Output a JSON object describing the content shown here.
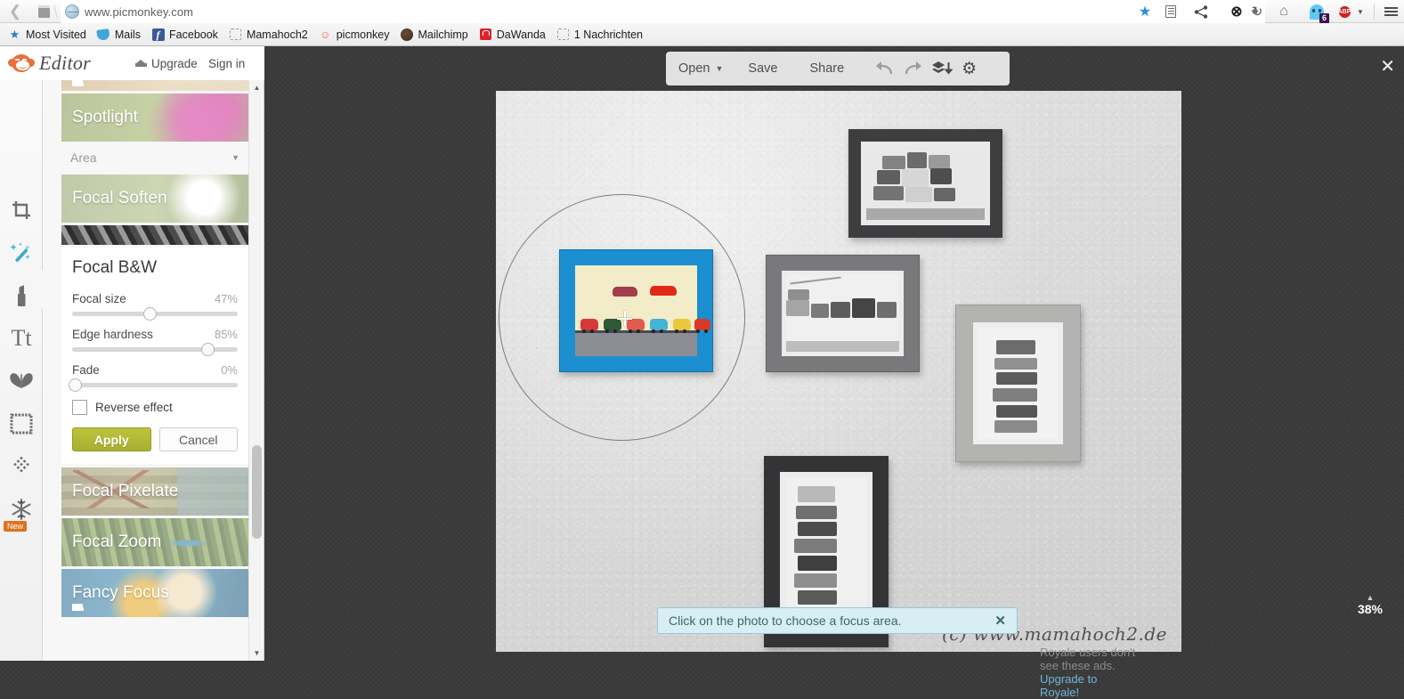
{
  "browser": {
    "url": "www.picmonkey.com",
    "back_icon": "back-arrow-icon",
    "reload_icon": "reload-icon",
    "bookmarks": [
      {
        "label": "Most Visited",
        "icon": "star-icon"
      },
      {
        "label": "Mails",
        "icon": "mail-icon"
      },
      {
        "label": "Facebook",
        "icon": "facebook-icon"
      },
      {
        "label": "Mamahoch2",
        "icon": "blank-favicon"
      },
      {
        "label": "picmonkey",
        "icon": "picmonkey-icon"
      },
      {
        "label": "Mailchimp",
        "icon": "mailchimp-icon"
      },
      {
        "label": "DaWanda",
        "icon": "dawanda-icon"
      },
      {
        "label": "1 Nachrichten",
        "icon": "blank-favicon"
      }
    ],
    "toolbar_icons": [
      "bookmark-star-icon",
      "reader-icon",
      "share-icon",
      "screenshot-icon",
      "chevron-down-icon",
      "home-icon",
      "ghostery-icon",
      "adblock-icon",
      "chevron-down-icon",
      "hamburger-menu-icon"
    ],
    "ghostery_badge": "6",
    "adblock_label": "ABP"
  },
  "app": {
    "logo_text": "Editor",
    "logo_icon": "monkey-icon",
    "upgrade_label": "Upgrade",
    "upgrade_icon": "crown-icon",
    "signin_label": "Sign in",
    "close_icon": "close-icon"
  },
  "tools": [
    {
      "name": "crop",
      "icon": "crop-icon",
      "active": false
    },
    {
      "name": "effects",
      "icon": "magic-wand-icon",
      "active": true
    },
    {
      "name": "touch-up",
      "icon": "lipstick-icon",
      "active": false
    },
    {
      "name": "text",
      "icon": "text-icon",
      "label": "Tt",
      "active": false
    },
    {
      "name": "overlays",
      "icon": "butterfly-icon",
      "active": false
    },
    {
      "name": "frames",
      "icon": "frame-icon",
      "active": false
    },
    {
      "name": "textures",
      "icon": "texture-icon",
      "active": false
    },
    {
      "name": "seasonal",
      "icon": "snowflake-icon",
      "badge": "New",
      "active": false
    }
  ],
  "toolbar": {
    "open_label": "Open",
    "open_caret_icon": "chevron-down-icon",
    "save_label": "Save",
    "share_label": "Share",
    "undo_icon": "undo-icon",
    "redo_icon": "redo-icon",
    "layers_icon": "layers-down-icon",
    "settings_icon": "gear-icon"
  },
  "effects_panel": {
    "area_label": "Area",
    "area_caret_icon": "chevron-down-icon",
    "scroll_up_icon": "triangle-up-icon",
    "scroll_down_icon": "triangle-down-icon",
    "items_above": [
      {
        "label": "",
        "premium": true,
        "thumb": "th-gold"
      },
      {
        "label": "Spotlight",
        "premium": false,
        "thumb": "th-spotlight"
      }
    ],
    "items": [
      {
        "label": "Focal Soften",
        "premium": false,
        "thumb": "th-soften"
      },
      {
        "label": "Focal B&W",
        "premium": false,
        "thumb": "th-bw"
      }
    ],
    "items_below": [
      {
        "label": "Focal Pixelate",
        "premium": false,
        "thumb": "th-pixelate"
      },
      {
        "label": "Focal Zoom",
        "premium": false,
        "thumb": "th-zoom"
      },
      {
        "label": "Fancy Focus",
        "premium": true,
        "thumb": "th-fancy"
      }
    ],
    "focal_card": {
      "title": "Focal B&W",
      "sliders": [
        {
          "label": "Focal size",
          "value": "47%",
          "pos": 47
        },
        {
          "label": "Edge hardness",
          "value": "85%",
          "pos": 82
        },
        {
          "label": "Fade",
          "value": "0%",
          "pos": 0
        }
      ],
      "reverse_label": "Reverse effect",
      "reverse_checked": false,
      "apply_label": "Apply",
      "cancel_label": "Cancel",
      "apply_color": "#b0b936"
    }
  },
  "canvas": {
    "watermark": "(c) www.mamahoch2.de",
    "focal_marker_icon": "focal-circle-marker",
    "crosshair_icon": "crosshair-cursor-icon"
  },
  "toast": {
    "message": "Click on the photo to choose a focus area.",
    "close_icon": "close-icon"
  },
  "zoom": {
    "level": "38%",
    "caret_icon": "triangle-up-icon"
  },
  "ads": {
    "line1": "Royale users don't",
    "line2": "see these ads.",
    "line3": "Upgrade to",
    "line4": "Royale!"
  }
}
